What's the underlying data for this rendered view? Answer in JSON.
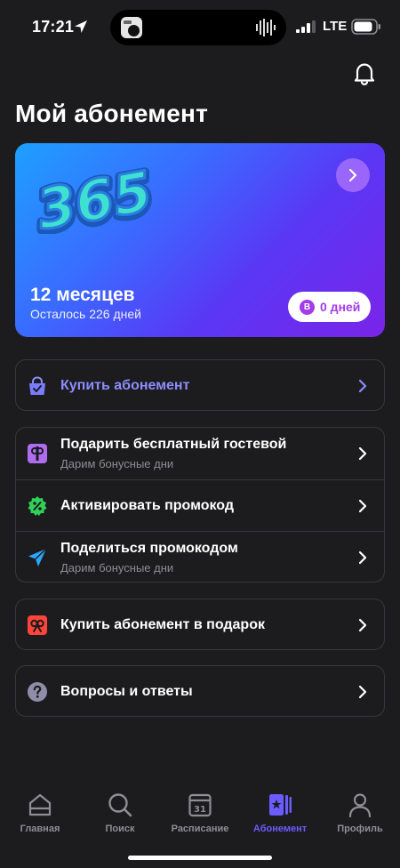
{
  "status_bar": {
    "time": "17:21",
    "network": "LTE"
  },
  "header": {
    "title": "Мой абонемент"
  },
  "subscription": {
    "logo_text": "365",
    "period": "12 месяцев",
    "remaining": "Осталось 226 дней",
    "bonus_coin": "B",
    "bonus_days": "0 дней"
  },
  "menu": {
    "buy": {
      "title": "Купить абонемент"
    },
    "gift_guest": {
      "title": "Подарить бесплатный гостевой",
      "subtitle": "Дарим бонусные дни"
    },
    "activate_promo": {
      "title": "Активировать промокод"
    },
    "share_promo": {
      "title": "Поделиться промокодом",
      "subtitle": "Дарим бонусные дни"
    },
    "buy_gift": {
      "title": "Купить абонемент в подарок"
    },
    "faq": {
      "title": "Вопросы и ответы"
    }
  },
  "tabs": [
    {
      "label": "Главная",
      "icon": "home-icon"
    },
    {
      "label": "Поиск",
      "icon": "search-icon"
    },
    {
      "label": "Расписание",
      "icon": "calendar-icon",
      "calendar_day": "31"
    },
    {
      "label": "Абонемент",
      "icon": "pass-icon",
      "active": true
    },
    {
      "label": "Профиль",
      "icon": "profile-icon"
    }
  ],
  "colors": {
    "accent": "#6a5cff",
    "background": "#1c1c1e",
    "card_border": "#38383c"
  }
}
